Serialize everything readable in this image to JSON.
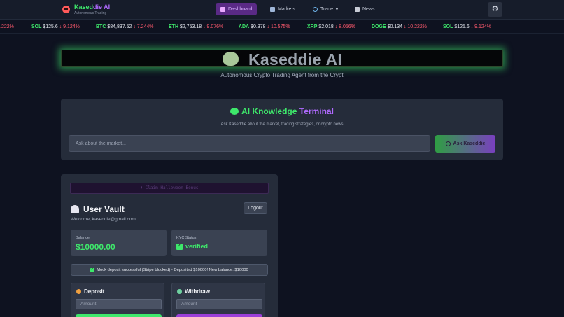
{
  "header": {
    "brand_part1": "Kased",
    "brand_part2": "die AI",
    "tagline": "Autonomous Trading",
    "nav": [
      {
        "label": "Dashboard"
      },
      {
        "label": "Markets"
      },
      {
        "label": "Trade ▼"
      },
      {
        "label": "News"
      }
    ]
  },
  "ticker": [
    {
      "sym": "",
      "price": "",
      "change": ".222%"
    },
    {
      "sym": "SOL",
      "price": "$125.6",
      "change": "↓ 9.124%"
    },
    {
      "sym": "BTC",
      "price": "$84,837.52",
      "change": "↓ 7.244%"
    },
    {
      "sym": "ETH",
      "price": "$2,753.18",
      "change": "↓ 9.076%"
    },
    {
      "sym": "ADA",
      "price": "$0.378",
      "change": "↓ 10.575%"
    },
    {
      "sym": "XRP",
      "price": "$2.018",
      "change": "↓ 8.056%"
    },
    {
      "sym": "DOGE",
      "price": "$0.134",
      "change": "↓ 10.222%"
    },
    {
      "sym": "SOL",
      "price": "$125.6",
      "change": "↓ 9.124%"
    }
  ],
  "hero": {
    "title": "Kaseddie AI",
    "subtitle": "Autonomous Crypto Trading Agent from the Crypt"
  },
  "terminal": {
    "title_part1": "AI Knowledge",
    "title_part2": "Terminal",
    "subtitle": "Ask Kaseddie about the market, trading strategies, or crypto news",
    "placeholder": "Ask about the market...",
    "button": "Ask Kaseddie"
  },
  "vault": {
    "gh_button": "⬇ Claim Halloween Bonus",
    "title": "User Vault",
    "welcome": "Welcome, kaseddie@gmail.com",
    "logout": "Logout",
    "balance_label": "Balance",
    "balance_value": "$10000.00",
    "kyc_label": "KYC Status",
    "kyc_value": "verified",
    "notice": "Mock deposit successful (Stripe blocked) - Deposited $10000! New balance: $10000",
    "deposit_title": "Deposit",
    "withdraw_title": "Withdraw",
    "amount_placeholder": "Amount"
  },
  "colors": {
    "accent_green": "#3ee86b",
    "accent_purple": "#b06aff",
    "negative": "#ff5a6e"
  }
}
